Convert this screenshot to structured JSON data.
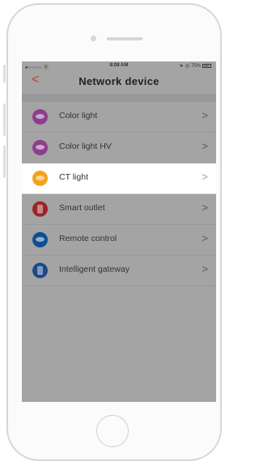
{
  "status_bar": {
    "carrier": "●○○○○ ⦿",
    "time": "8:08 AM",
    "battery": "75%",
    "location_glyph": "➤"
  },
  "nav": {
    "back_glyph": "<",
    "title": "Network device"
  },
  "devices": [
    {
      "label": "Color light",
      "icon": "color-light-icon",
      "color": "#8e3d8c",
      "chevron": ">"
    },
    {
      "label": "Color light HV",
      "icon": "color-light-hv-icon",
      "color": "#8e3d8c",
      "chevron": ">"
    },
    {
      "label": "CT light",
      "icon": "ct-light-icon",
      "color": "#f1a21d",
      "chevron": ">",
      "selected": true
    },
    {
      "label": "Smart outlet",
      "icon": "smart-outlet-icon",
      "color": "#9b2327",
      "chevron": ">"
    },
    {
      "label": "Remote control",
      "icon": "remote-control-icon",
      "color": "#0f4f8f",
      "chevron": ">"
    },
    {
      "label": "Intelligent gateway",
      "icon": "intelligent-gateway-icon",
      "color": "#1b4a87",
      "chevron": ">"
    }
  ]
}
